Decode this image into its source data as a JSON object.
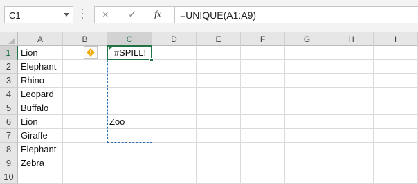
{
  "name_box": {
    "value": "C1"
  },
  "formula_bar": {
    "cancel_icon": "×",
    "enter_icon": "✓",
    "fx_label": "fx",
    "formula": "=UNIQUE(A1:A9)"
  },
  "columns": [
    "A",
    "B",
    "C",
    "D",
    "E",
    "F",
    "G",
    "H",
    "I"
  ],
  "selected_column": "C",
  "rows": [
    "1",
    "2",
    "3",
    "4",
    "5",
    "6",
    "7",
    "8",
    "9",
    "10"
  ],
  "selected_row": "1",
  "cells": {
    "A1": "Lion",
    "A2": "Elephant",
    "A3": "Rhino",
    "A4": "Leopard",
    "A5": "Buffalo",
    "A6": "Lion",
    "A7": "Giraffe",
    "A8": "Elephant",
    "A9": "Zebra",
    "C1": "#SPILL!",
    "C6": "Zoo"
  },
  "spill_warning": {
    "icon": "warning-icon",
    "color": "#f2a900"
  },
  "colors": {
    "accent": "#217346",
    "spill_border": "#2b6fb0"
  }
}
